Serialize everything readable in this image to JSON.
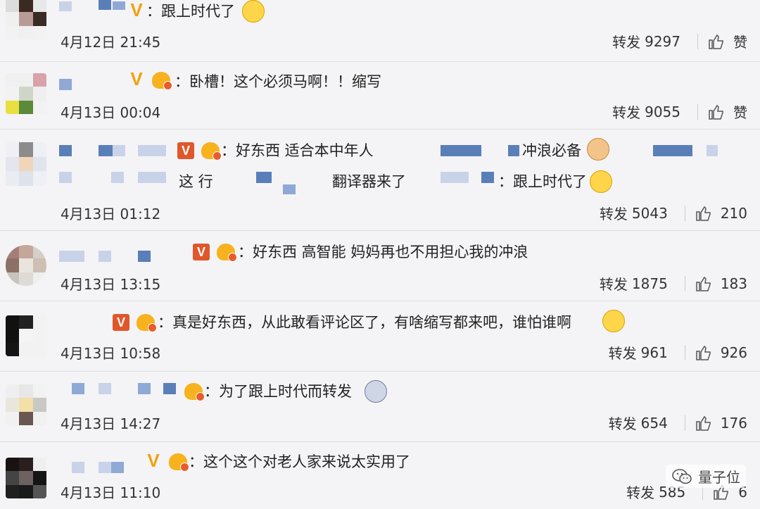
{
  "labels": {
    "repost": "转发",
    "like": "赞"
  },
  "comments": [
    {
      "text": "：跟上时代了",
      "date": "4月12日 21:45",
      "reposts": "9297",
      "likes": "赞"
    },
    {
      "text": "：卧槽！这个必须马啊！！缩写",
      "date": "4月13日 00:04",
      "reposts": "9055",
      "likes": "赞"
    },
    {
      "text": "：好东西 适合本中年人",
      "text_b": "冲浪必备",
      "text2": "这 行",
      "text2_b": "翻译器来了",
      "text2_c": "：跟上时代了",
      "date": "4月13日 01:12",
      "reposts": "5043",
      "likes": "210"
    },
    {
      "text": "：好东西 高智能 妈妈再也不用担心我的冲浪",
      "date": "4月13日 13:15",
      "reposts": "1875",
      "likes": "183"
    },
    {
      "text": "：真是好东西，从此敢看评论区了，有啥缩写都来吧，谁怕谁啊",
      "date": "4月13日 10:58",
      "reposts": "961",
      "likes": "926"
    },
    {
      "text": "：为了跟上时代而转发",
      "date": "4月13日 14:27",
      "reposts": "654",
      "likes": "176"
    },
    {
      "text": "：这个这个对老人家来说太实用了",
      "date": "4月13日 11:10",
      "reposts": "585",
      "likes": "6"
    }
  ],
  "watermark": {
    "label": "量子位"
  },
  "colors": {
    "vip_red": "#e0572b",
    "vip_gold": "#f2a10c",
    "crown": "#f7b21d",
    "bg": "#f4f4f6"
  },
  "icons": [
    "like-thumb-icon",
    "vip-badge-icon",
    "crown-badge-icon",
    "emoji-icon",
    "wechat-icon"
  ]
}
